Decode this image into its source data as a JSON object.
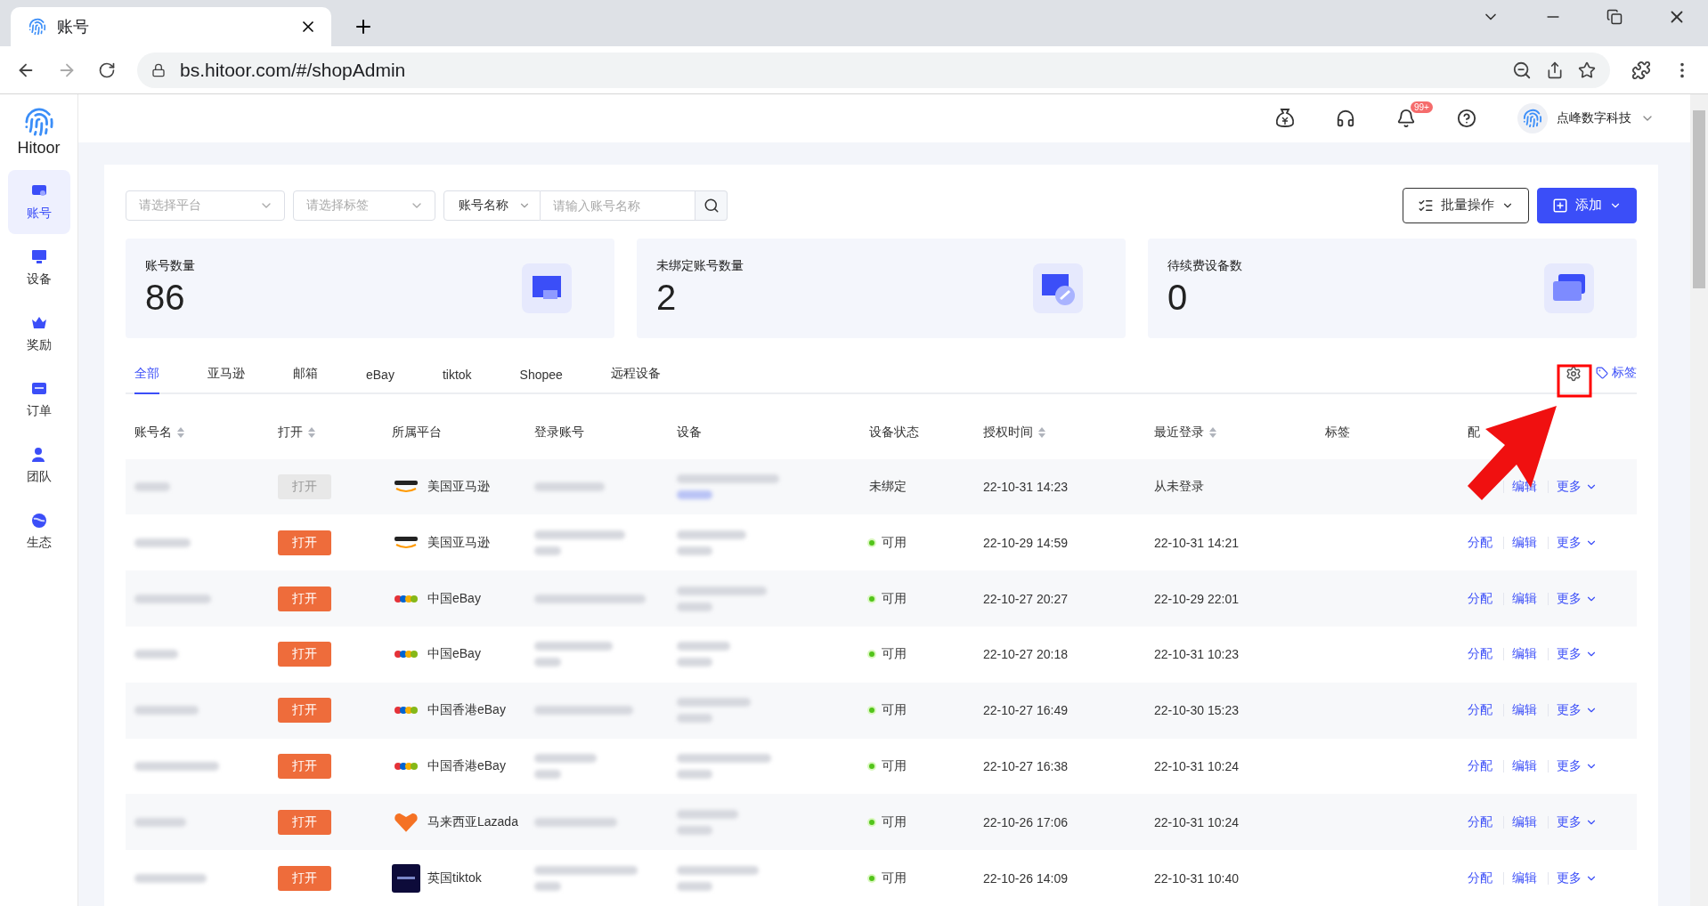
{
  "browser": {
    "tab_title": "账号",
    "url": "bs.hitoor.com/#/shopAdmin"
  },
  "sidebar": {
    "logo": "Hitoor",
    "items": [
      {
        "label": "账号",
        "selected": true
      },
      {
        "label": "设备",
        "selected": false
      },
      {
        "label": "奖励",
        "selected": false
      },
      {
        "label": "订单",
        "selected": false
      },
      {
        "label": "团队",
        "selected": false
      },
      {
        "label": "生态",
        "selected": false
      }
    ]
  },
  "header": {
    "notification_badge": "99+",
    "user": "点峰数字科技"
  },
  "filters": {
    "platform": {
      "placeholder": "请选择平台"
    },
    "tag": {
      "placeholder": "请选择标签"
    },
    "search_by": "账号名称",
    "search": {
      "placeholder": "请输入账号名称"
    }
  },
  "buttons": [
    {
      "label": "批量操作",
      "kind": "outline"
    },
    {
      "label": "添加",
      "kind": "primary"
    }
  ],
  "stats": [
    {
      "label": "账号数量",
      "value": "86"
    },
    {
      "label": "未绑定账号数量",
      "value": "2"
    },
    {
      "label": "待续费设备数",
      "value": "0"
    }
  ],
  "tabs": [
    {
      "label": "全部",
      "selected": true
    },
    {
      "label": "亚马逊",
      "selected": false
    },
    {
      "label": "邮箱",
      "selected": false
    },
    {
      "label": "eBay",
      "selected": false
    },
    {
      "label": "tiktok",
      "selected": false
    },
    {
      "label": "Shopee",
      "selected": false
    },
    {
      "label": "远程设备",
      "selected": false
    }
  ],
  "tag_link": "标签",
  "table": {
    "columns": [
      {
        "label": "账号名",
        "sortable": true
      },
      {
        "label": "打开",
        "sortable": true
      },
      {
        "label": "所属平台",
        "sortable": false
      },
      {
        "label": "登录账号",
        "sortable": false
      },
      {
        "label": "设备",
        "sortable": false
      },
      {
        "label": "设备状态",
        "sortable": false
      },
      {
        "label": "授权时间",
        "sortable": true
      },
      {
        "label": "最近登录",
        "sortable": true
      },
      {
        "label": "标签",
        "sortable": false
      },
      {
        "label": "配"
      }
    ],
    "rows": [
      {
        "open": {
          "label": "打开",
          "disabled": true
        },
        "kind": "amazon",
        "platform": "美国亚马逊",
        "status": "未绑定",
        "available": false,
        "authorized": "22-10-31 14:23",
        "last_login": "从未登录",
        "actions": [
          {
            "label": "编辑",
            "kind": "edit"
          },
          {
            "label": "更多",
            "kind": "more"
          }
        ]
      },
      {
        "open": {
          "label": "打开",
          "disabled": false
        },
        "kind": "amazon",
        "platform": "美国亚马逊",
        "status": "可用",
        "available": true,
        "authorized": "22-10-29 14:59",
        "last_login": "22-10-31 14:21",
        "actions": [
          {
            "label": "分配",
            "kind": "assign"
          },
          {
            "label": "编辑",
            "kind": "edit"
          },
          {
            "label": "更多",
            "kind": "more"
          }
        ]
      },
      {
        "open": {
          "label": "打开",
          "disabled": false
        },
        "kind": "ebay",
        "platform": "中国eBay",
        "status": "可用",
        "available": true,
        "authorized": "22-10-27 20:27",
        "last_login": "22-10-29 22:01",
        "actions": [
          {
            "label": "分配",
            "kind": "assign"
          },
          {
            "label": "编辑",
            "kind": "edit"
          },
          {
            "label": "更多",
            "kind": "more"
          }
        ]
      },
      {
        "open": {
          "label": "打开",
          "disabled": false
        },
        "kind": "ebay",
        "platform": "中国eBay",
        "status": "可用",
        "available": true,
        "authorized": "22-10-27 20:18",
        "last_login": "22-10-31 10:23",
        "actions": [
          {
            "label": "分配",
            "kind": "assign"
          },
          {
            "label": "编辑",
            "kind": "edit"
          },
          {
            "label": "更多",
            "kind": "more"
          }
        ]
      },
      {
        "open": {
          "label": "打开",
          "disabled": false
        },
        "kind": "ebay",
        "platform": "中国香港eBay",
        "status": "可用",
        "available": true,
        "authorized": "22-10-27 16:49",
        "last_login": "22-10-30 15:23",
        "actions": [
          {
            "label": "分配",
            "kind": "assign"
          },
          {
            "label": "编辑",
            "kind": "edit"
          },
          {
            "label": "更多",
            "kind": "more"
          }
        ]
      },
      {
        "open": {
          "label": "打开",
          "disabled": false
        },
        "kind": "ebay",
        "platform": "中国香港eBay",
        "status": "可用",
        "available": true,
        "authorized": "22-10-27 16:38",
        "last_login": "22-10-31 10:24",
        "actions": [
          {
            "label": "分配",
            "kind": "assign"
          },
          {
            "label": "编辑",
            "kind": "edit"
          },
          {
            "label": "更多",
            "kind": "more"
          }
        ]
      },
      {
        "open": {
          "label": "打开",
          "disabled": false
        },
        "kind": "lazada",
        "platform": "马来西亚Lazada",
        "status": "可用",
        "available": true,
        "authorized": "22-10-26 17:06",
        "last_login": "22-10-31 10:24",
        "actions": [
          {
            "label": "分配",
            "kind": "assign"
          },
          {
            "label": "编辑",
            "kind": "edit"
          },
          {
            "label": "更多",
            "kind": "more"
          }
        ]
      },
      {
        "open": {
          "label": "打开",
          "disabled": false
        },
        "kind": "tiktok",
        "platform": "英国tiktok",
        "status": "可用",
        "available": true,
        "authorized": "22-10-26 14:09",
        "last_login": "22-10-31 10:40",
        "actions": [
          {
            "label": "分配",
            "kind": "assign"
          },
          {
            "label": "编辑",
            "kind": "edit"
          },
          {
            "label": "更多",
            "kind": "more"
          }
        ]
      }
    ]
  }
}
